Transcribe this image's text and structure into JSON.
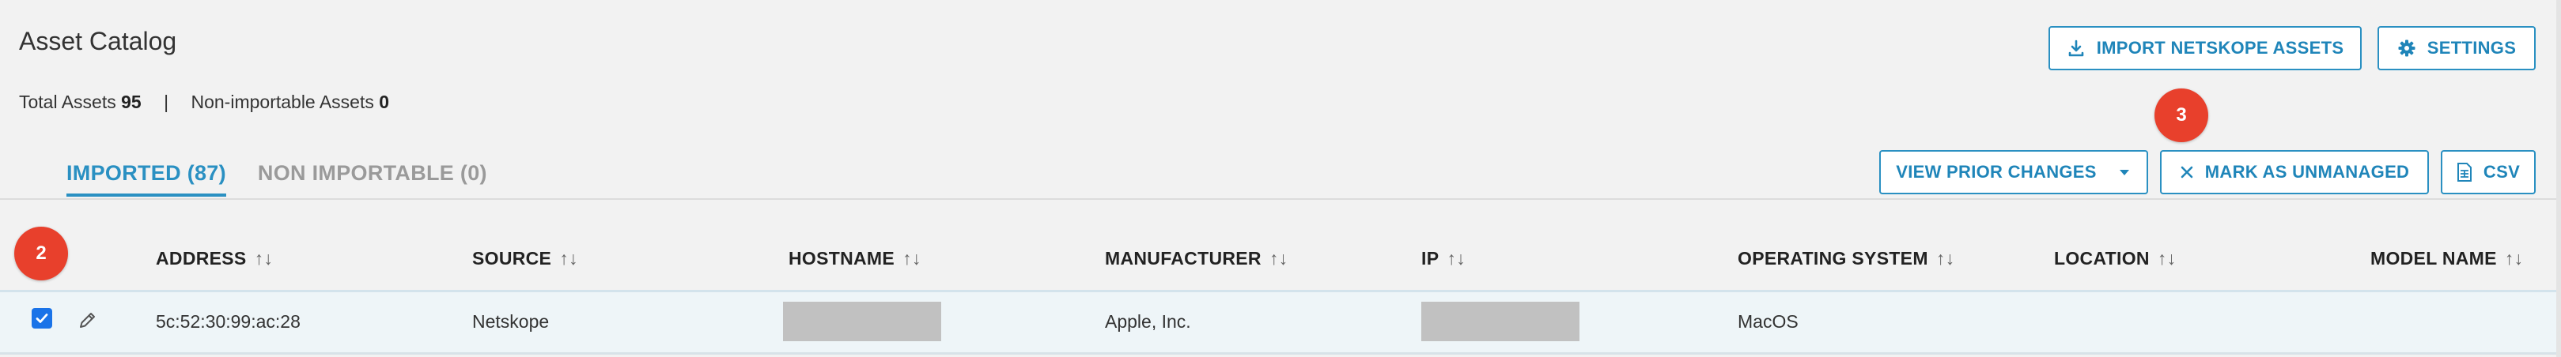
{
  "page": {
    "title": "Asset Catalog"
  },
  "totals": {
    "total_label": "Total Assets",
    "total_value": "95",
    "separator": "|",
    "nonimport_label": "Non-importable Assets",
    "nonimport_value": "0"
  },
  "actions": {
    "import_label": "IMPORT NETSKOPE ASSETS",
    "settings_label": "SETTINGS",
    "prior_changes_label": "VIEW PRIOR CHANGES",
    "mark_unmanaged_label": "MARK AS UNMANAGED",
    "csv_label": "CSV"
  },
  "badges": {
    "step_3": "3",
    "step_2": "2"
  },
  "tabs": [
    {
      "label": "IMPORTED (87)",
      "active": true
    },
    {
      "label": "NON IMPORTABLE (0)",
      "active": false
    }
  ],
  "table": {
    "sort_glyph": "↑↓",
    "columns": [
      "ADDRESS",
      "SOURCE",
      "HOSTNAME",
      "MANUFACTURER",
      "IP",
      "OPERATING SYSTEM",
      "LOCATION",
      "MODEL NAME"
    ],
    "rows": [
      {
        "selected": true,
        "address": "5c:52:30:99:ac:28",
        "source": "Netskope",
        "hostname": "",
        "manufacturer": "Apple, Inc.",
        "ip": "",
        "operating_system": "MacOS",
        "location": "",
        "model_name": ""
      }
    ]
  },
  "icons": {
    "import": "download-icon",
    "settings": "gear-icon",
    "prior_changes": "caret-down-icon",
    "mark_unmanaged": "close-icon",
    "csv": "spreadsheet-icon",
    "edit": "pencil-icon",
    "checkbox": "checkmark-icon"
  },
  "colors": {
    "accent": "#2a90c2",
    "badge": "#e8402c",
    "checkbox": "#1a73e8",
    "row_selected": "#eef5f8",
    "background": "#f2f2f2",
    "redaction": "#c1c1c1"
  }
}
